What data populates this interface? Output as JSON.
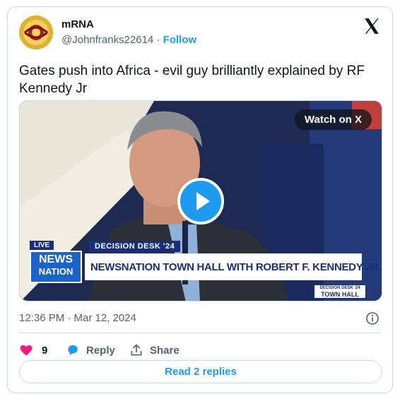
{
  "author": {
    "name": "mRNA",
    "handle": "@Johnfranks22614",
    "separator": "·",
    "follow_label": "Follow"
  },
  "tweet": {
    "text": "Gates push into Africa - evil guy brilliantly explained by RF Kennedy Jr",
    "timestamp": "12:36 PM · Mar 12, 2024"
  },
  "media": {
    "watch_label": "Watch on X",
    "live_label": "LIVE",
    "network_top": "NEWS",
    "network_bottom": "NATION",
    "segment_label": "DECISION DESK '24",
    "headline": "NEWSNATION TOWN HALL WITH ROBERT F. KENNEDY JR.",
    "corner_top": "DECISION DESK '24",
    "corner_bottom": "TOWN HALL"
  },
  "actions": {
    "like_count": "9",
    "reply_label": "Reply",
    "share_label": "Share"
  },
  "read_replies_label": "Read 2 replies",
  "colors": {
    "accent": "#1d9bf0",
    "like": "#f91880",
    "muted": "#536471",
    "border": "#cfd9de"
  }
}
